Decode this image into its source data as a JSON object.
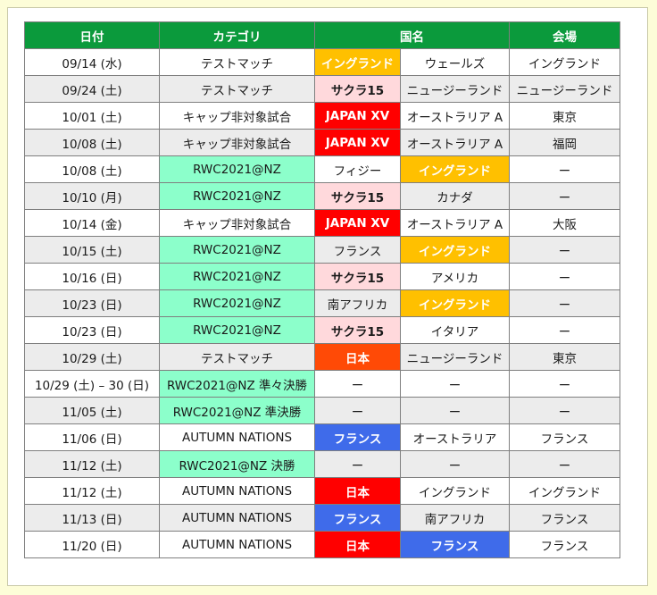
{
  "headers": {
    "date": "日付",
    "category": "カテゴリ",
    "country": "国名",
    "venue": "会場"
  },
  "rows": [
    {
      "date": "09/14 (水)",
      "category": "テストマッチ",
      "team1": "イングランド",
      "team2": "ウェールズ",
      "venue": "イングランド"
    },
    {
      "date": "09/24 (土)",
      "category": "テストマッチ",
      "team1": "サクラ15",
      "team2": "ニュージーランド",
      "venue": "ニュージーランド"
    },
    {
      "date": "10/01 (土)",
      "category": "キャップ非対象試合",
      "team1": "JAPAN XV",
      "team2": "オーストラリア A",
      "venue": "東京"
    },
    {
      "date": "10/08 (土)",
      "category": "キャップ非対象試合",
      "team1": "JAPAN XV",
      "team2": "オーストラリア A",
      "venue": "福岡"
    },
    {
      "date": "10/08 (土)",
      "category": "RWC2021@NZ",
      "team1": "フィジー",
      "team2": "イングランド",
      "venue": "ー"
    },
    {
      "date": "10/10 (月)",
      "category": "RWC2021@NZ",
      "team1": "サクラ15",
      "team2": "カナダ",
      "venue": "ー"
    },
    {
      "date": "10/14 (金)",
      "category": "キャップ非対象試合",
      "team1": "JAPAN XV",
      "team2": "オーストラリア A",
      "venue": "大阪"
    },
    {
      "date": "10/15 (土)",
      "category": "RWC2021@NZ",
      "team1": "フランス",
      "team2": "イングランド",
      "venue": "ー"
    },
    {
      "date": "10/16 (日)",
      "category": "RWC2021@NZ",
      "team1": "サクラ15",
      "team2": "アメリカ",
      "venue": "ー"
    },
    {
      "date": "10/23 (日)",
      "category": "RWC2021@NZ",
      "team1": "南アフリカ",
      "team2": "イングランド",
      "venue": "ー"
    },
    {
      "date": "10/23 (日)",
      "category": "RWC2021@NZ",
      "team1": "サクラ15",
      "team2": "イタリア",
      "venue": "ー"
    },
    {
      "date": "10/29 (土)",
      "category": "テストマッチ",
      "team1": "日本",
      "team2": "ニュージーランド",
      "venue": "東京"
    },
    {
      "date": "10/29 (土) – 30 (日)",
      "category": "RWC2021@NZ 準々決勝",
      "team1": "ー",
      "team2": "ー",
      "venue": "ー"
    },
    {
      "date": "11/05 (土)",
      "category": "RWC2021@NZ 準決勝",
      "team1": "ー",
      "team2": "ー",
      "venue": "ー"
    },
    {
      "date": "11/06 (日)",
      "category": "AUTUMN NATIONS",
      "team1": "フランス",
      "team2": "オーストラリア",
      "venue": "フランス"
    },
    {
      "date": "11/12 (土)",
      "category": "RWC2021@NZ 決勝",
      "team1": "ー",
      "team2": "ー",
      "venue": "ー"
    },
    {
      "date": "11/12 (土)",
      "category": "AUTUMN NATIONS",
      "team1": "日本",
      "team2": "イングランド",
      "venue": "イングランド"
    },
    {
      "date": "11/13 (日)",
      "category": "AUTUMN NATIONS",
      "team1": "フランス",
      "team2": "南アフリカ",
      "venue": "フランス"
    },
    {
      "date": "11/20 (日)",
      "category": "AUTUMN NATIONS",
      "team1": "日本",
      "team2": "フランス",
      "venue": "フランス"
    }
  ],
  "colors": {
    "header_green": "#0b9a3c",
    "rwc_green": "#8cffcb",
    "england_orange": "#ffc000",
    "sakura_pink": "#ffd9dc",
    "japan_red": "#ff0000",
    "japan_testmatch_redorange": "#ff4a06",
    "france_blue": "#3f6bea",
    "row_gray": "#ececec",
    "page_bg": "#fdfdd8"
  }
}
